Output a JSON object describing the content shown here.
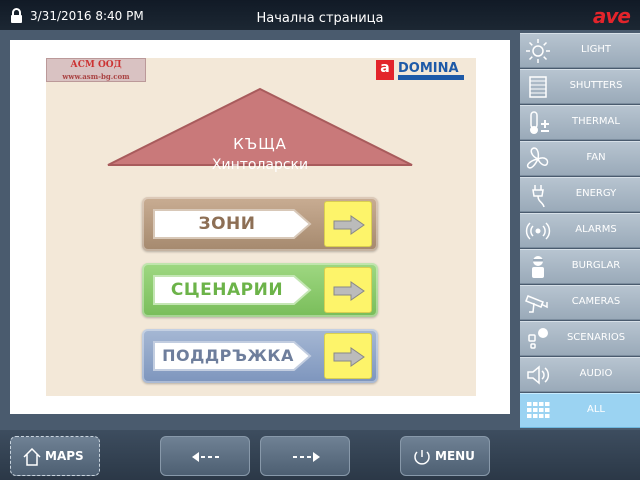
{
  "topbar": {
    "datetime": "3/31/2016 8:40 PM",
    "title": "Начална страница",
    "brand": "ave",
    "lock_icon": "lock-icon"
  },
  "floorplan": {
    "asm_logo": {
      "line1": "АСМ ООД",
      "line2": "www.asm-bg.com"
    },
    "domina_logo": {
      "a": "a",
      "word": "DOMINA"
    },
    "house": {
      "line1": "КЪЩА",
      "line2": "Хинтоларски"
    },
    "buttons": [
      {
        "label": "ЗОНИ",
        "color": "#a5896e"
      },
      {
        "label": "СЦЕНАРИИ",
        "color": "#79bd5a"
      },
      {
        "label": "ПОДДРЪЖКА",
        "color": "#7d95bd"
      }
    ]
  },
  "sidebar": {
    "items": [
      {
        "label": "LIGHT",
        "icon": "sun-icon"
      },
      {
        "label": "SHUTTERS",
        "icon": "shutters-icon"
      },
      {
        "label": "THERMAL",
        "icon": "thermometer-icon"
      },
      {
        "label": "FAN",
        "icon": "fan-icon"
      },
      {
        "label": "ENERGY",
        "icon": "plug-icon"
      },
      {
        "label": "ALARMS",
        "icon": "alarm-waves-icon"
      },
      {
        "label": "BURGLAR",
        "icon": "burglar-icon"
      },
      {
        "label": "CAMERAS",
        "icon": "camera-icon"
      },
      {
        "label": "SCENARIOS",
        "icon": "scenarios-icon"
      },
      {
        "label": "AUDIO",
        "icon": "speaker-icon"
      },
      {
        "label": "ALL",
        "icon": "grid-icon",
        "active": true
      }
    ]
  },
  "bottombar": {
    "maps_label": "MAPS",
    "menu_label": "MENU",
    "back_icon": "back-arrow-icon",
    "forward_icon": "forward-arrow-icon"
  },
  "colors": {
    "accent_active": "#9bd3f2",
    "brand_red": "#e3242b",
    "topbar_bg": "#111a26",
    "button_arrow_bg": "#fdf46a"
  }
}
